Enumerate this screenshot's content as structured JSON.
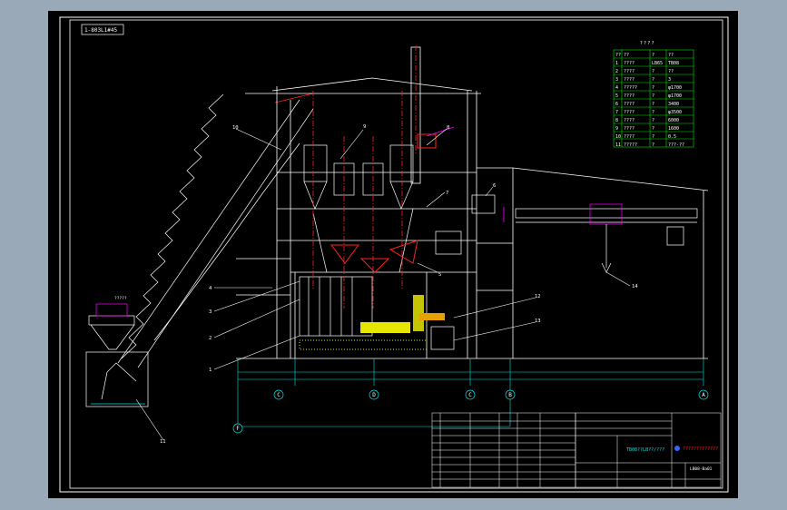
{
  "drawing": {
    "title_box": "1-803L1#45",
    "parts_table": {
      "heading": "? ? ? ?",
      "header": [
        "??",
        "??",
        "?",
        "??"
      ],
      "rows": [
        [
          "1",
          "????",
          "LB65",
          "TB08"
        ],
        [
          "2",
          "????",
          "?",
          "??"
        ],
        [
          "3",
          "????",
          "?",
          "3"
        ],
        [
          "4",
          "?????",
          "?",
          "φ1700"
        ],
        [
          "5",
          "????",
          "?",
          "φ1700"
        ],
        [
          "6",
          "????",
          "?",
          "3400"
        ],
        [
          "7",
          "????",
          "?",
          "φ3500"
        ],
        [
          "8",
          "????",
          "?",
          "6000"
        ],
        [
          "9",
          "????",
          "?",
          "1600"
        ],
        [
          "10",
          "????",
          "?",
          "0.5"
        ],
        [
          "11",
          "?????",
          "?",
          "???-??"
        ]
      ]
    },
    "callouts": [
      "1",
      "2",
      "3",
      "4",
      "5",
      "6",
      "7",
      "8",
      "9",
      "10",
      "11",
      "12",
      "13",
      "14",
      "13???"
    ],
    "axis_labels": [
      "C",
      "D",
      "C",
      "B",
      "A",
      "F"
    ],
    "title_block": {
      "name": "TB08??LB??/???",
      "drawing_no": "LB08-Ba01",
      "company": "?????????????"
    }
  },
  "colors": {
    "background": "#9aa9b8",
    "drawing_bg": "#000000",
    "border": "#ffffff",
    "primary_line": "#ffffff",
    "dimension": "#00e6e6",
    "table_line": "#00e600",
    "centerline": "#ff2222",
    "accent": "#ff00ff",
    "fill_yellow": "#e6e600"
  }
}
